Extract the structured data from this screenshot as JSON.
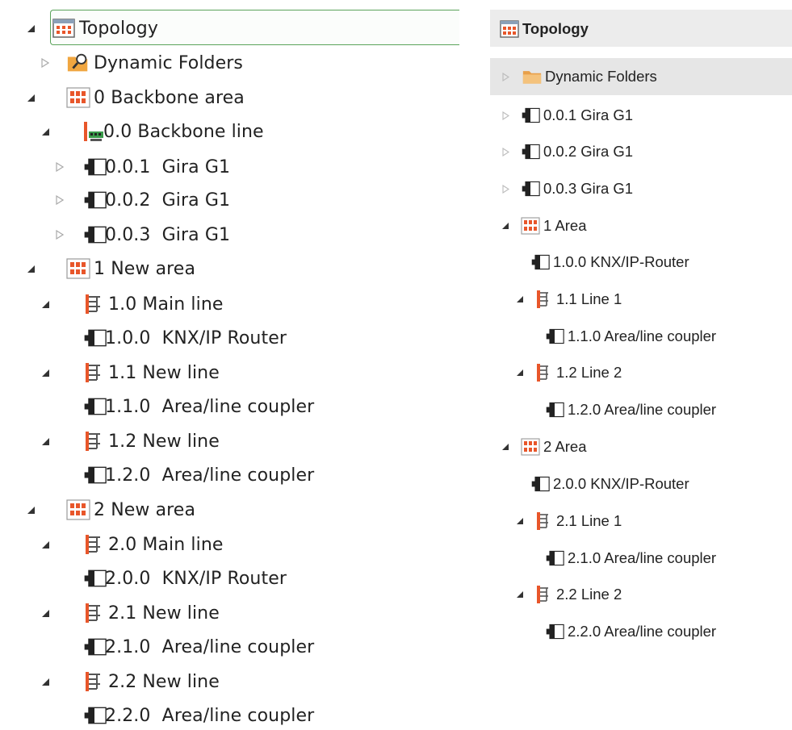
{
  "left_tree": {
    "title": "Topology",
    "items": [
      {
        "label": "Dynamic Folders",
        "icon": "dynamic-folder-search-icon",
        "state": "collapsed"
      },
      {
        "label": "0 Backbone area",
        "icon": "area-icon",
        "state": "expanded"
      },
      {
        "label": "0.0 Backbone line",
        "icon": "backbone-line-icon",
        "state": "expanded"
      },
      {
        "label": "0.0.1  Gira G1",
        "icon": "device-icon",
        "state": "collapsed"
      },
      {
        "label": "0.0.2  Gira G1",
        "icon": "device-icon",
        "state": "collapsed"
      },
      {
        "label": "0.0.3  Gira G1",
        "icon": "device-icon",
        "state": "collapsed"
      },
      {
        "label": "1 New area",
        "icon": "area-icon",
        "state": "expanded"
      },
      {
        "label": "1.0 Main line",
        "icon": "line-icon",
        "state": "expanded"
      },
      {
        "label": "1.0.0  KNX/IP Router",
        "icon": "device-icon",
        "state": "leaf"
      },
      {
        "label": "1.1 New line",
        "icon": "line-icon",
        "state": "expanded"
      },
      {
        "label": "1.1.0  Area/line coupler",
        "icon": "device-icon",
        "state": "leaf"
      },
      {
        "label": "1.2 New line",
        "icon": "line-icon",
        "state": "expanded"
      },
      {
        "label": "1.2.0  Area/line coupler",
        "icon": "device-icon",
        "state": "leaf"
      },
      {
        "label": "2 New area",
        "icon": "area-icon",
        "state": "expanded"
      },
      {
        "label": "2.0 Main line",
        "icon": "line-icon",
        "state": "expanded"
      },
      {
        "label": "2.0.0  KNX/IP Router",
        "icon": "device-icon",
        "state": "leaf"
      },
      {
        "label": "2.1 New line",
        "icon": "line-icon",
        "state": "expanded"
      },
      {
        "label": "2.1.0  Area/line coupler",
        "icon": "device-icon",
        "state": "leaf"
      },
      {
        "label": "2.2 New line",
        "icon": "line-icon",
        "state": "expanded"
      },
      {
        "label": "2.2.0  Area/line coupler",
        "icon": "device-icon",
        "state": "leaf"
      }
    ]
  },
  "right_tree": {
    "title": "Topology",
    "items": [
      {
        "label": "Dynamic Folders",
        "icon": "folder-icon",
        "state": "collapsed"
      },
      {
        "label": "0.0.1 Gira G1",
        "icon": "device-icon",
        "state": "collapsed"
      },
      {
        "label": "0.0.2 Gira G1",
        "icon": "device-icon",
        "state": "collapsed"
      },
      {
        "label": "0.0.3 Gira G1",
        "icon": "device-icon",
        "state": "collapsed"
      },
      {
        "label": "1 Area",
        "icon": "area-icon",
        "state": "expanded"
      },
      {
        "label": "1.0.0 KNX/IP-Router",
        "icon": "device-icon",
        "state": "leaf"
      },
      {
        "label": "1.1 Line 1",
        "icon": "line-icon",
        "state": "expanded"
      },
      {
        "label": "1.1.0 Area/line coupler",
        "icon": "device-icon",
        "state": "leaf"
      },
      {
        "label": "1.2 Line 2",
        "icon": "line-icon",
        "state": "expanded"
      },
      {
        "label": "1.2.0 Area/line coupler",
        "icon": "device-icon",
        "state": "leaf"
      },
      {
        "label": "2 Area",
        "icon": "area-icon",
        "state": "expanded"
      },
      {
        "label": "2.0.0 KNX/IP-Router",
        "icon": "device-icon",
        "state": "leaf"
      },
      {
        "label": "2.1 Line 1",
        "icon": "line-icon",
        "state": "expanded"
      },
      {
        "label": "2.1.0 Area/line coupler",
        "icon": "device-icon",
        "state": "leaf"
      },
      {
        "label": "2.2 Line 2",
        "icon": "line-icon",
        "state": "expanded"
      },
      {
        "label": "2.2.0 Area/line coupler",
        "icon": "device-icon",
        "state": "leaf"
      }
    ]
  },
  "colors": {
    "accent_orange": "#e8562a",
    "selection_border": "#5aa35a",
    "header_gray": "#ececec"
  }
}
